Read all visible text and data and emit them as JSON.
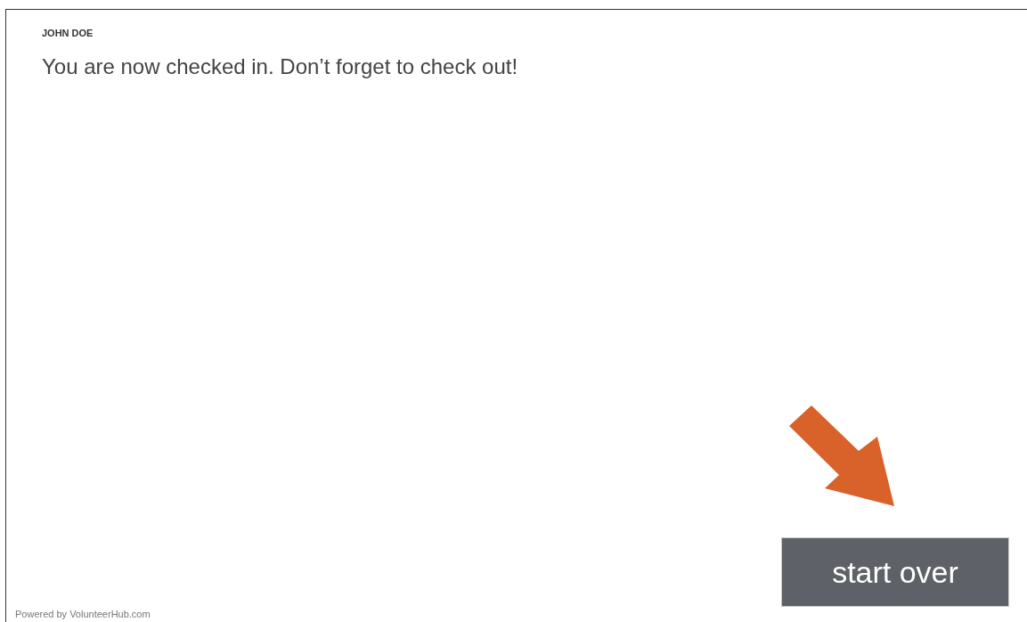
{
  "user_name": "JOHN DOE",
  "message": "You are now checked in. Don’t forget to check out!",
  "start_over_button": {
    "label": "start over"
  },
  "footer": "Powered by VolunteerHub.com"
}
